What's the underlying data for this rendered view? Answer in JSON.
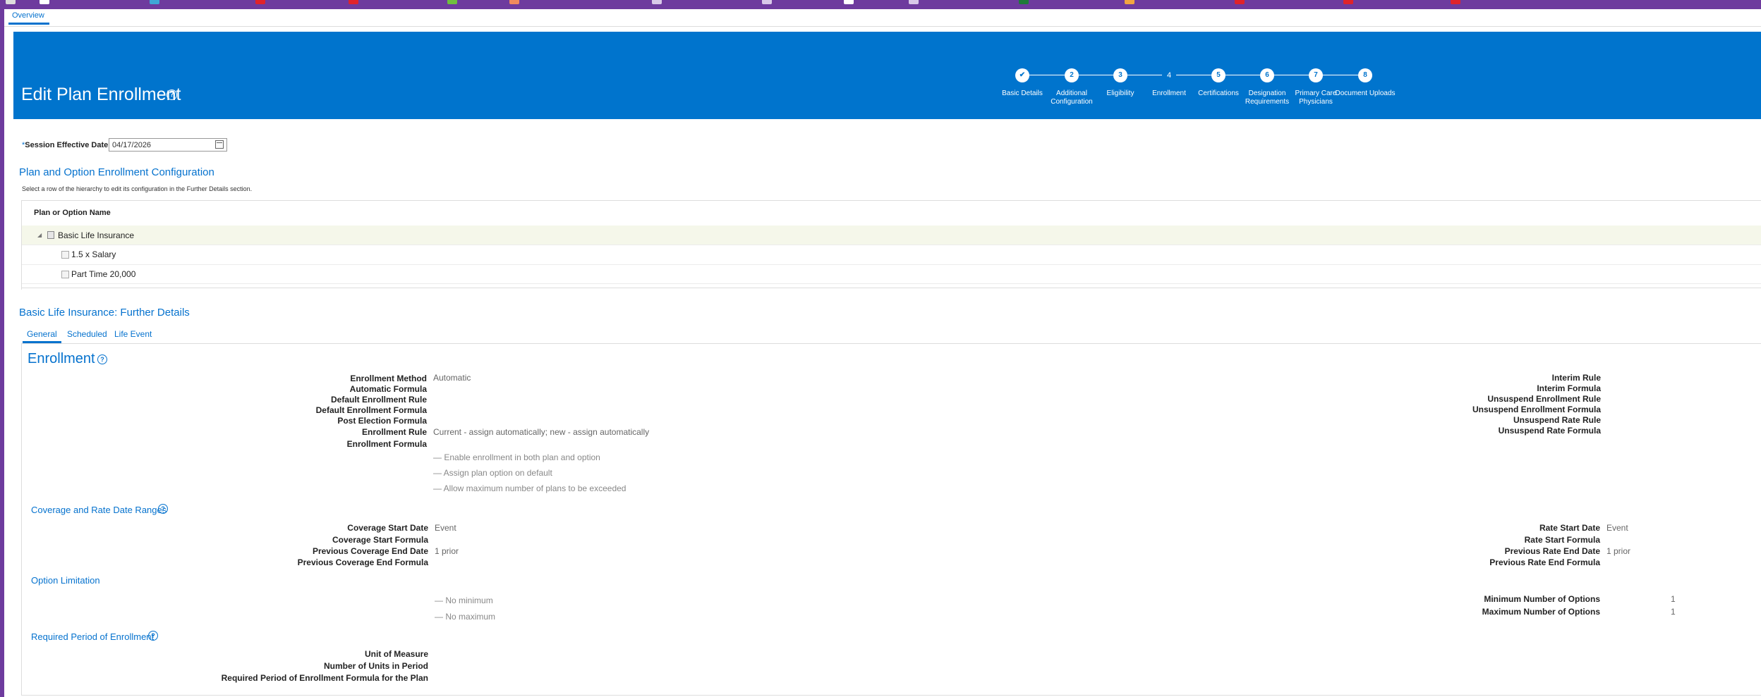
{
  "tabs": {
    "overview": "Overview"
  },
  "header": {
    "title": "Edit Plan Enrollment"
  },
  "train": {
    "steps": [
      {
        "num": "",
        "label": "Basic Details"
      },
      {
        "num": "2",
        "label": "Additional Configuration"
      },
      {
        "num": "3",
        "label": "Eligibility"
      },
      {
        "num": "4",
        "label": "Enrollment"
      },
      {
        "num": "5",
        "label": "Certifications"
      },
      {
        "num": "6",
        "label": "Designation Requirements"
      },
      {
        "num": "7",
        "label": "Primary Care Physicians"
      },
      {
        "num": "8",
        "label": "Document Uploads"
      }
    ]
  },
  "session": {
    "required_mark": "*",
    "label": "Session Effective Date",
    "value": "04/17/2026"
  },
  "config": {
    "title": "Plan and Option Enrollment Configuration",
    "instruction": "Select a row of the hierarchy to edit its configuration in the Further Details section.",
    "column_header": "Plan or Option Name",
    "rows": {
      "plan": "Basic Life Insurance",
      "option1": "1.5 x Salary",
      "option2": "Part Time 20,000"
    }
  },
  "details": {
    "title": "Basic Life Insurance: Further Details",
    "tabs": {
      "general": "General",
      "scheduled": "Scheduled",
      "life_event": "Life Event"
    }
  },
  "enrollment": {
    "title": "Enrollment",
    "labels": {
      "method": "Enrollment Method",
      "auto_formula": "Automatic Formula",
      "default_rule": "Default Enrollment Rule",
      "default_formula": "Default Enrollment Formula",
      "post_election": "Post Election Formula",
      "rule": "Enrollment Rule",
      "formula": "Enrollment Formula"
    },
    "values": {
      "method": "Automatic",
      "rule": "Current - assign automatically; new - assign automatically"
    },
    "checkboxes": {
      "both": "Enable enrollment in both plan and option",
      "assign": "Assign plan option on default",
      "max": "Allow maximum number of plans to be exceeded"
    },
    "right_labels": {
      "interim_rule": "Interim Rule",
      "interim_formula": "Interim Formula",
      "unsuspend_enroll_rule": "Unsuspend Enrollment Rule",
      "unsuspend_enroll_formula": "Unsuspend Enrollment Formula",
      "unsuspend_rate_rule": "Unsuspend Rate Rule",
      "unsuspend_rate_formula": "Unsuspend Rate Formula"
    }
  },
  "coverage": {
    "title": "Coverage and Rate Date Ranges",
    "labels": {
      "start_date": "Coverage Start Date",
      "start_formula": "Coverage Start Formula",
      "prev_end_date": "Previous Coverage End Date",
      "prev_end_formula": "Previous Coverage End Formula"
    },
    "values": {
      "start_date": "Event",
      "prev_end_date": "1 prior"
    },
    "rate_labels": {
      "start_date": "Rate Start Date",
      "start_formula": "Rate Start Formula",
      "prev_end_date": "Previous Rate End Date",
      "prev_end_formula": "Previous Rate End Formula"
    },
    "rate_values": {
      "start_date": "Event",
      "prev_end_date": "1 prior"
    }
  },
  "option_limitation": {
    "title": "Option Limitation",
    "checkboxes": {
      "no_min": "No minimum",
      "no_max": "No maximum"
    },
    "labels": {
      "min": "Minimum Number of Options",
      "max": "Maximum Number of Options"
    },
    "values": {
      "min": "1",
      "max": "1"
    }
  },
  "required_period": {
    "title": "Required Period of Enrollment",
    "labels": {
      "unit": "Unit of Measure",
      "units": "Number of Units in Period",
      "formula": "Required Period of Enrollment Formula for the Plan"
    }
  },
  "colors": {
    "banner": "#0074cd",
    "accent": "#0572ce",
    "window_frame": "#6e3b9e"
  }
}
